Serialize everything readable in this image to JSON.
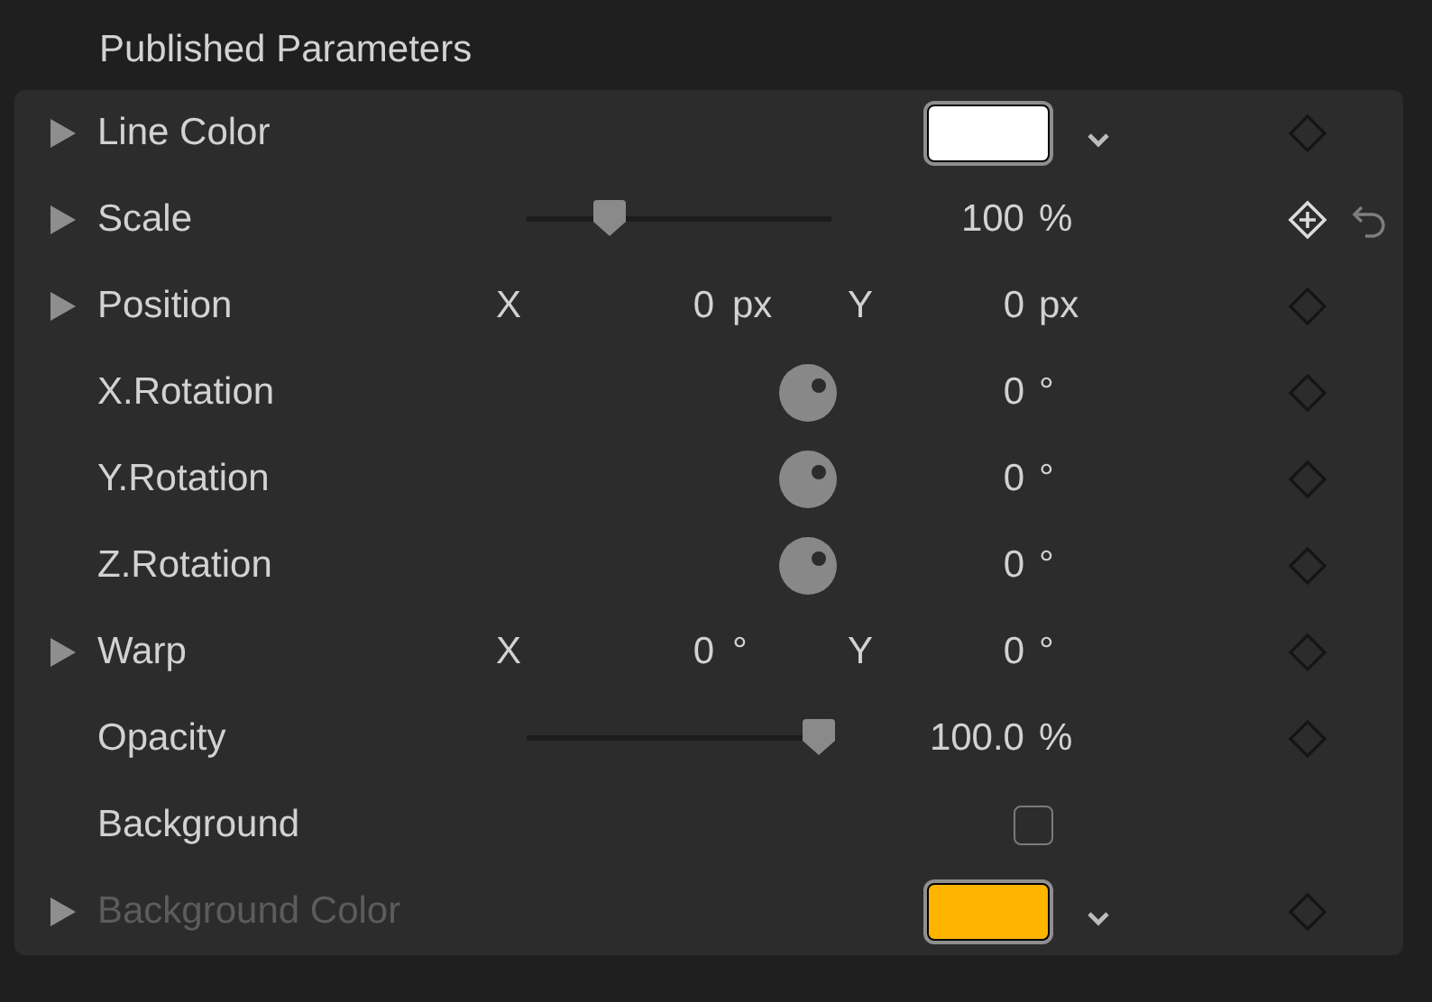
{
  "title": "Published Parameters",
  "rows": [
    {
      "kind": "color",
      "label": "Line Color",
      "expandable": true,
      "disabled": false,
      "color": "#ffffff",
      "keyframe": true,
      "keyframe_here": false,
      "reset": false
    },
    {
      "kind": "slider",
      "label": "Scale",
      "expandable": true,
      "disabled": false,
      "level": 0.27,
      "value": "100",
      "unit": "%",
      "keyframe": true,
      "keyframe_here": true,
      "reset": true
    },
    {
      "kind": "xy",
      "label": "Position",
      "expandable": true,
      "disabled": false,
      "x_label": "X",
      "x_value": "0",
      "x_unit": "px",
      "y_label": "Y",
      "y_value": "0",
      "y_unit": "px",
      "keyframe": true,
      "keyframe_here": false,
      "reset": false
    },
    {
      "kind": "dial",
      "label": "X.Rotation",
      "expandable": false,
      "disabled": false,
      "value": "0",
      "unit": "°",
      "keyframe": true,
      "keyframe_here": false,
      "reset": false
    },
    {
      "kind": "dial",
      "label": "Y.Rotation",
      "expandable": false,
      "disabled": false,
      "value": "0",
      "unit": "°",
      "keyframe": true,
      "keyframe_here": false,
      "reset": false
    },
    {
      "kind": "dial",
      "label": "Z.Rotation",
      "expandable": false,
      "disabled": false,
      "value": "0",
      "unit": "°",
      "keyframe": true,
      "keyframe_here": false,
      "reset": false
    },
    {
      "kind": "xy",
      "label": "Warp",
      "expandable": true,
      "disabled": false,
      "x_label": "X",
      "x_value": "0",
      "x_unit": "°",
      "y_label": "Y",
      "y_value": "0",
      "y_unit": "°",
      "keyframe": true,
      "keyframe_here": false,
      "reset": false
    },
    {
      "kind": "slider",
      "label": "Opacity",
      "expandable": false,
      "disabled": false,
      "level": 0.96,
      "value": "100.0",
      "unit": "%",
      "keyframe": true,
      "keyframe_here": false,
      "reset": false
    },
    {
      "kind": "checkbox",
      "label": "Background",
      "expandable": false,
      "disabled": false,
      "checked": false,
      "keyframe": false,
      "reset": false
    },
    {
      "kind": "color",
      "label": "Background Color",
      "expandable": true,
      "disabled": true,
      "color": "#ffb400",
      "keyframe": true,
      "keyframe_here": false,
      "reset": false
    }
  ]
}
